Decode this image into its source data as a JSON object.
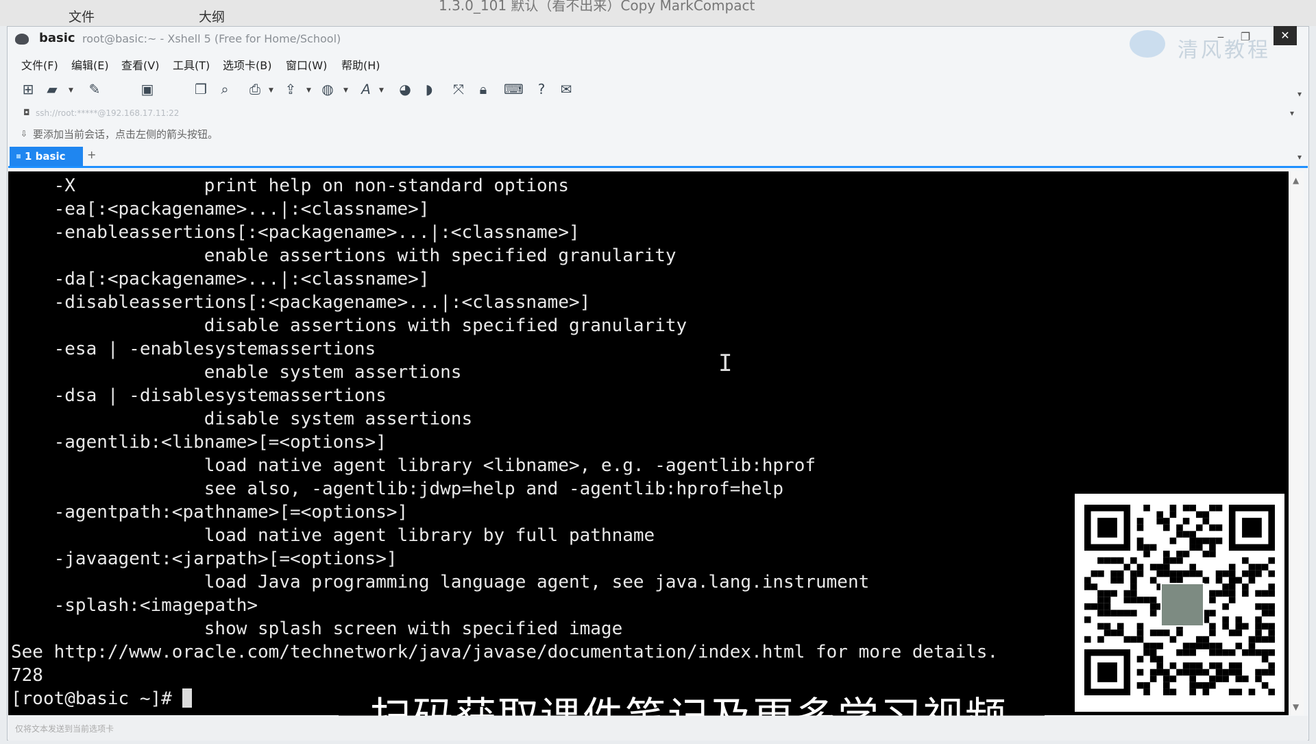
{
  "background": {
    "menu_file": "文件",
    "menu_outline": "大纲",
    "doc_title": "1.3.0_101 默认（看不出来）Copy MarkCompact"
  },
  "window": {
    "session_name": "basic",
    "title": "root@basic:~ - Xshell 5 (Free for Home/School)",
    "watermark": "清风教程"
  },
  "menu": [
    "文件(F)",
    "编辑(E)",
    "查看(V)",
    "工具(T)",
    "选项卡(B)",
    "窗口(W)",
    "帮助(H)"
  ],
  "address_bar": {
    "text": "ssh://root:*****@192.168.17.11:22"
  },
  "info_bar": {
    "text": "要添加当前会话，点击左侧的箭头按钮。"
  },
  "tabs": [
    {
      "label": "1 basic",
      "active": true
    }
  ],
  "terminal": {
    "lines": [
      "    -X            print help on non-standard options",
      "    -ea[:<packagename>...|:<classname>]",
      "    -enableassertions[:<packagename>...|:<classname>]",
      "                  enable assertions with specified granularity",
      "    -da[:<packagename>...|:<classname>]",
      "    -disableassertions[:<packagename>...|:<classname>]",
      "                  disable assertions with specified granularity",
      "    -esa | -enablesystemassertions",
      "                  enable system assertions",
      "    -dsa | -disablesystemassertions",
      "                  disable system assertions",
      "    -agentlib:<libname>[=<options>]",
      "                  load native agent library <libname>, e.g. -agentlib:hprof",
      "                  see also, -agentlib:jdwp=help and -agentlib:hprof=help",
      "    -agentpath:<pathname>[=<options>]",
      "                  load native agent library by full pathname",
      "    -javaagent:<jarpath>[=<options>]",
      "                  load Java programming language agent, see java.lang.instrument",
      "    -splash:<imagepath>",
      "                  show splash screen with specified image",
      "See http://www.oracle.com/technetwork/java/javase/documentation/index.html for more details.",
      "728"
    ],
    "prompt": "[root@basic ~]# "
  },
  "caption": "扫码获取课件笔记及更多学习视频",
  "status_bar": {
    "text": "仅将文本发送到当前选项卡"
  },
  "colors": {
    "tab_active": "#1f86f0",
    "terminal_bg": "#000000",
    "terminal_fg": "#e8e8e8"
  },
  "icons": [
    "new-session-icon",
    "open-folder-icon",
    "reconnect-icon",
    "properties-icon",
    "copy-icon",
    "find-icon",
    "print-icon",
    "transfer-icon",
    "globe-icon",
    "font-icon",
    "xftp-icon",
    "script-icon",
    "fullscreen-icon",
    "lock-icon",
    "keyboard-icon",
    "help-icon",
    "chat-icon"
  ]
}
